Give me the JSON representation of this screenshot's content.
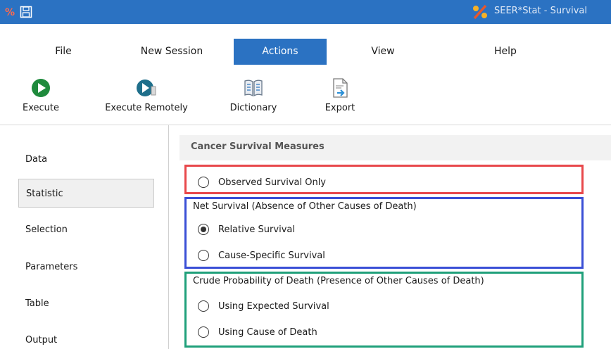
{
  "window": {
    "title": "SEER*Stat - Survival"
  },
  "menu": {
    "items": [
      {
        "label": "File"
      },
      {
        "label": "New Session"
      },
      {
        "label": "Actions",
        "active": true
      },
      {
        "label": "View"
      },
      {
        "label": "Help"
      }
    ]
  },
  "toolbar": {
    "execute_label": "Execute",
    "execute_remotely_label": "Execute Remotely",
    "dictionary_label": "Dictionary",
    "export_label": "Export"
  },
  "nav": {
    "items": [
      {
        "label": "Data"
      },
      {
        "label": "Statistic",
        "selected": true
      },
      {
        "label": "Selection"
      },
      {
        "label": "Parameters"
      },
      {
        "label": "Table"
      },
      {
        "label": "Output"
      }
    ]
  },
  "panel": {
    "title": "Cancer Survival Measures",
    "observed_option": "Observed Survival Only",
    "net_group_label": "Net Survival (Absence of Other Causes of Death)",
    "relative_option": "Relative Survival",
    "cause_specific_option": "Cause-Specific Survival",
    "crude_group_label": "Crude Probability of Death (Presence of Other Causes of Death)",
    "expected_option": "Using Expected Survival",
    "cause_of_death_option": "Using Cause of Death",
    "selected_option": "Relative Survival"
  },
  "colors": {
    "titlebar": "#2b72c2",
    "highlight_red": "#e8484b",
    "highlight_blue": "#3a4fd6",
    "highlight_green": "#1fa07a",
    "execute_green": "#1e8a3c",
    "execute_remote_teal": "#1f6f8b"
  },
  "icons": {
    "app": "seerstat-percent-icon",
    "save": "save-icon",
    "execute": "play-icon",
    "execute_remotely": "play-remote-icon",
    "dictionary": "book-icon",
    "export": "export-document-icon"
  }
}
